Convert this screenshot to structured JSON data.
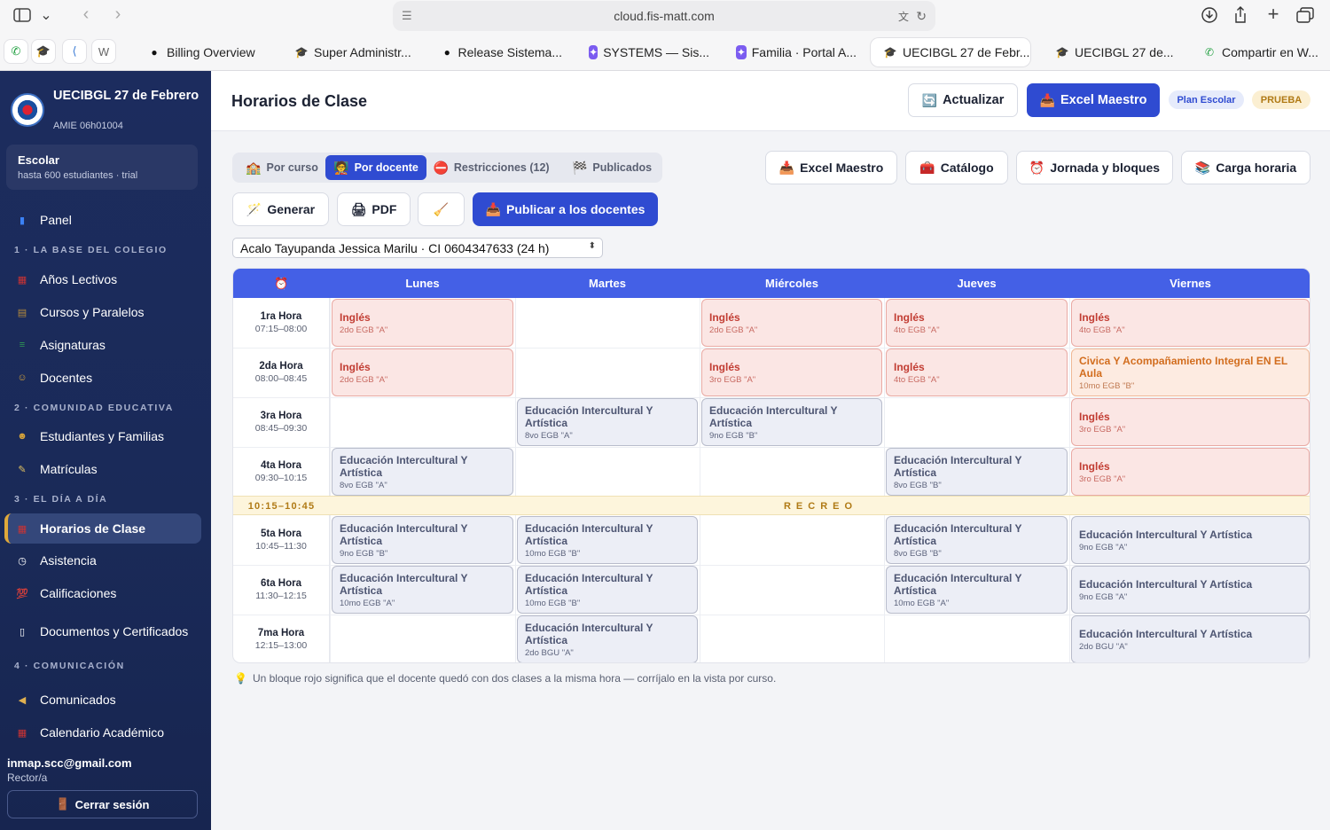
{
  "browser": {
    "url": "cloud.fis-matt.com",
    "pinned": [
      "whatsapp-icon",
      "school-icon",
      "app-icon",
      "w-icon"
    ],
    "tabs": [
      {
        "label": "Billing Overview",
        "icon": "github-icon"
      },
      {
        "label": "Super Administr...",
        "icon": "school-icon"
      },
      {
        "label": "Release Sistema...",
        "icon": "github-icon"
      },
      {
        "label": "SYSTEMS — Sis...",
        "icon": "star-icon"
      },
      {
        "label": "Familia · Portal A...",
        "icon": "star-icon"
      },
      {
        "label": "UECIBGL 27 de Febr...",
        "icon": "school-icon",
        "active": true
      },
      {
        "label": "UECIBGL 27 de...",
        "icon": "school-icon"
      },
      {
        "label": "Compartir en W...",
        "icon": "whatsapp-icon"
      }
    ]
  },
  "sidebar": {
    "school_name": "UECIBGL 27 de Febrero",
    "amie": "AMIE 06h01004",
    "plan_title": "Escolar",
    "plan_sub": "hasta 600 estudiantes · trial",
    "items": [
      {
        "label": "Panel",
        "icon": "chart-icon"
      },
      {
        "section": "1 · LA BASE DEL COLEGIO"
      },
      {
        "label": "Años Lectivos",
        "icon": "calendar-icon"
      },
      {
        "label": "Cursos y Paralelos",
        "icon": "building-icon"
      },
      {
        "label": "Asignaturas",
        "icon": "books-icon"
      },
      {
        "label": "Docentes",
        "icon": "teacher-icon"
      },
      {
        "section": "2 · COMUNIDAD EDUCATIVA"
      },
      {
        "label": "Estudiantes y Familias",
        "icon": "student-icon"
      },
      {
        "label": "Matrículas",
        "icon": "memo-icon"
      },
      {
        "section": "3 · EL DÍA A DÍA"
      },
      {
        "label": "Horarios de Clase",
        "icon": "calendar-icon",
        "active": true
      },
      {
        "label": "Asistencia",
        "icon": "clock-icon"
      },
      {
        "label": "Calificaciones",
        "icon": "hundred-icon"
      },
      {
        "label": "Documentos y Certificados",
        "icon": "document-icon"
      },
      {
        "section": "4 · COMUNICACIÓN"
      },
      {
        "label": "Comunicados",
        "icon": "megaphone-icon"
      },
      {
        "label": "Calendario Académico",
        "icon": "calendar-icon"
      }
    ],
    "user_email": "inmap.scc@gmail.com",
    "user_role": "Rector/a",
    "logout": "Cerrar sesión"
  },
  "header": {
    "title": "Horarios de Clase",
    "refresh": "Actualizar",
    "excel": "Excel Maestro",
    "plan_pill": "Plan Escolar",
    "test_pill": "PRUEBA"
  },
  "tabs": [
    "Por curso",
    "Por docente",
    "Restricciones (12)",
    "Publicados"
  ],
  "actions": {
    "excel": "Excel Maestro",
    "catalog": "Catálogo",
    "jornada": "Jornada y bloques",
    "carga": "Carga horaria",
    "generate": "Generar",
    "pdf": "PDF",
    "publish": "Publicar a los docentes"
  },
  "teacher_select": "Acalo Tayupanda Jessica Marilu · CI 0604347633 (24 h)",
  "schedule": {
    "corner_icon": "alarm-clock-icon",
    "days": [
      "Lunes",
      "Martes",
      "Miércoles",
      "Jueves",
      "Viernes"
    ],
    "periods": [
      {
        "name": "1ra Hora",
        "time": "07:15–08:00"
      },
      {
        "name": "2da Hora",
        "time": "08:00–08:45"
      },
      {
        "name": "3ra Hora",
        "time": "08:45–09:30"
      },
      {
        "name": "4ta Hora",
        "time": "09:30–10:15"
      },
      {
        "name": "5ta Hora",
        "time": "10:45–11:30"
      },
      {
        "name": "6ta Hora",
        "time": "11:30–12:15"
      },
      {
        "name": "7ma Hora",
        "time": "12:15–13:00"
      }
    ],
    "recreo_time": "10:15–10:45",
    "recreo_label": "RECREO",
    "cells": [
      {
        "p": 0,
        "d": 0,
        "subject": "Inglés",
        "course": "2do EGB \"A\"",
        "status": "conflict"
      },
      {
        "p": 0,
        "d": 2,
        "subject": "Inglés",
        "course": "2do EGB \"A\"",
        "status": "conflict"
      },
      {
        "p": 0,
        "d": 3,
        "subject": "Inglés",
        "course": "4to EGB \"A\"",
        "status": "conflict"
      },
      {
        "p": 0,
        "d": 4,
        "subject": "Inglés",
        "course": "4to EGB \"A\"",
        "status": "conflict"
      },
      {
        "p": 1,
        "d": 0,
        "subject": "Inglés",
        "course": "2do EGB \"A\"",
        "status": "conflict"
      },
      {
        "p": 1,
        "d": 2,
        "subject": "Inglés",
        "course": "3ro EGB \"A\"",
        "status": "conflict"
      },
      {
        "p": 1,
        "d": 3,
        "subject": "Inglés",
        "course": "4to EGB \"A\"",
        "status": "conflict"
      },
      {
        "p": 1,
        "d": 4,
        "subject": "Civica Y Acompañamiento Integral EN EL Aula",
        "course": "10mo EGB \"B\"",
        "status": "other"
      },
      {
        "p": 2,
        "d": 1,
        "subject": "Educación Intercultural Y Artística",
        "course": "8vo EGB \"A\"",
        "status": "normal"
      },
      {
        "p": 2,
        "d": 2,
        "subject": "Educación Intercultural Y Artística",
        "course": "9no EGB \"B\"",
        "status": "normal"
      },
      {
        "p": 2,
        "d": 4,
        "subject": "Inglés",
        "course": "3ro EGB \"A\"",
        "status": "conflict"
      },
      {
        "p": 3,
        "d": 0,
        "subject": "Educación Intercultural Y Artística",
        "course": "8vo EGB \"A\"",
        "status": "normal"
      },
      {
        "p": 3,
        "d": 3,
        "subject": "Educación Intercultural Y Artística",
        "course": "8vo EGB \"B\"",
        "status": "normal"
      },
      {
        "p": 3,
        "d": 4,
        "subject": "Inglés",
        "course": "3ro EGB \"A\"",
        "status": "conflict"
      },
      {
        "p": 4,
        "d": 0,
        "subject": "Educación Intercultural Y Artística",
        "course": "9no EGB \"B\"",
        "status": "normal"
      },
      {
        "p": 4,
        "d": 1,
        "subject": "Educación Intercultural Y Artística",
        "course": "10mo EGB \"B\"",
        "status": "normal"
      },
      {
        "p": 4,
        "d": 3,
        "subject": "Educación Intercultural Y Artística",
        "course": "8vo EGB \"B\"",
        "status": "normal"
      },
      {
        "p": 4,
        "d": 4,
        "subject": "Educación Intercultural Y Artística",
        "course": "9no EGB \"A\"",
        "status": "normal"
      },
      {
        "p": 5,
        "d": 0,
        "subject": "Educación Intercultural Y Artística",
        "course": "10mo EGB \"A\"",
        "status": "normal"
      },
      {
        "p": 5,
        "d": 1,
        "subject": "Educación Intercultural Y Artística",
        "course": "10mo EGB \"B\"",
        "status": "normal"
      },
      {
        "p": 5,
        "d": 3,
        "subject": "Educación Intercultural Y Artística",
        "course": "10mo EGB \"A\"",
        "status": "normal"
      },
      {
        "p": 5,
        "d": 4,
        "subject": "Educación Intercultural Y Artística",
        "course": "9no EGB \"A\"",
        "status": "normal"
      },
      {
        "p": 6,
        "d": 1,
        "subject": "Educación Intercultural Y Artística",
        "course": "2do BGU \"A\"",
        "status": "normal"
      },
      {
        "p": 6,
        "d": 4,
        "subject": "Educación Intercultural Y Artística",
        "course": "2do BGU \"A\"",
        "status": "normal"
      }
    ]
  },
  "note": "Un bloque rojo significa que el docente quedó con dos clases a la misma hora — corríjalo en la vista por curso.",
  "colors": {
    "accent": "#2f4bd1",
    "header_blue": "#4460e6",
    "conflict_red": "#c23d33",
    "sidebar": "#1c2c5e"
  }
}
